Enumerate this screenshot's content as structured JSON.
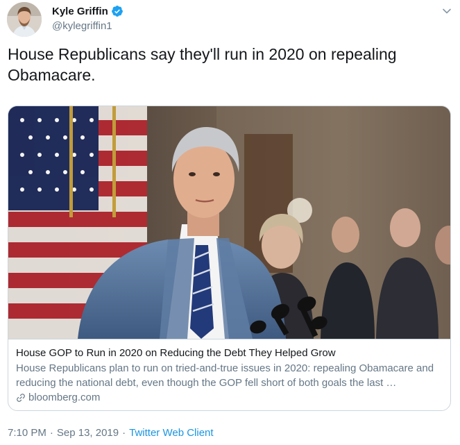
{
  "author": {
    "display_name": "Kyle Griffin",
    "handle": "@kylegriffin1",
    "verified": true
  },
  "tweet": {
    "text": "House Republicans say they'll run in 2020 on repealing Obamacare.",
    "time": "7:10 PM",
    "separator": "·",
    "date": "Sep 13, 2019",
    "source": "Twitter Web Client"
  },
  "card": {
    "title": "House GOP to Run in 2020 on Reducing the Debt They Helped Grow",
    "description": "House Republicans plan to run on tried-and-true issues in 2020: repealing Obamacare and reducing the national debt, even though the GOP fell short of both goals the last …",
    "domain": "bloomberg.com"
  },
  "icons": {
    "verified": "verified-badge-icon",
    "caret": "chevron-down-icon",
    "link": "link-icon"
  },
  "colors": {
    "accent": "#1da1f2",
    "link": "#1b95e0",
    "secondary_text": "#657786",
    "primary_text": "#14171a",
    "border": "#ccd6dd"
  }
}
